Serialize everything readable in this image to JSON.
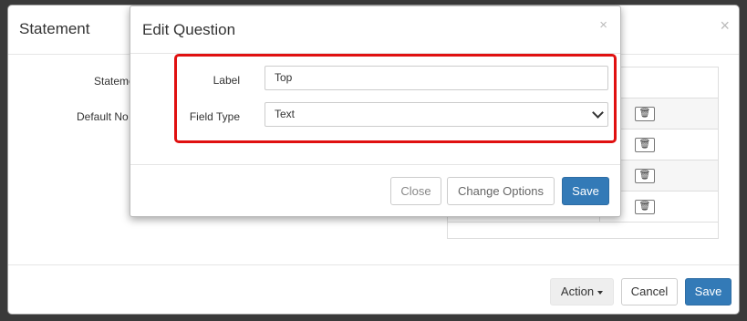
{
  "outer_modal": {
    "title": "Statement",
    "close_glyph": "×",
    "fields": [
      {
        "label": "Stateme"
      },
      {
        "label": "Default No"
      }
    ],
    "table_row_icons": [
      "edit-icon",
      "trash-icon"
    ],
    "trash_glyph": "🗑",
    "edit_glyph": "✎",
    "footer": {
      "action_label": "Action",
      "cancel_label": "Cancel",
      "save_label": "Save"
    }
  },
  "inner_modal": {
    "title": "Edit Question",
    "close_glyph": "×",
    "fields": {
      "label_caption": "Label",
      "label_value": "Top",
      "field_type_caption": "Field Type",
      "field_type_value": "Text"
    },
    "footer": {
      "close_label": "Close",
      "change_options_label": "Change Options",
      "save_label": "Save"
    }
  },
  "colors": {
    "primary": "#337ab7",
    "highlight": "#e01010",
    "backdrop": "#3a3a3a"
  }
}
